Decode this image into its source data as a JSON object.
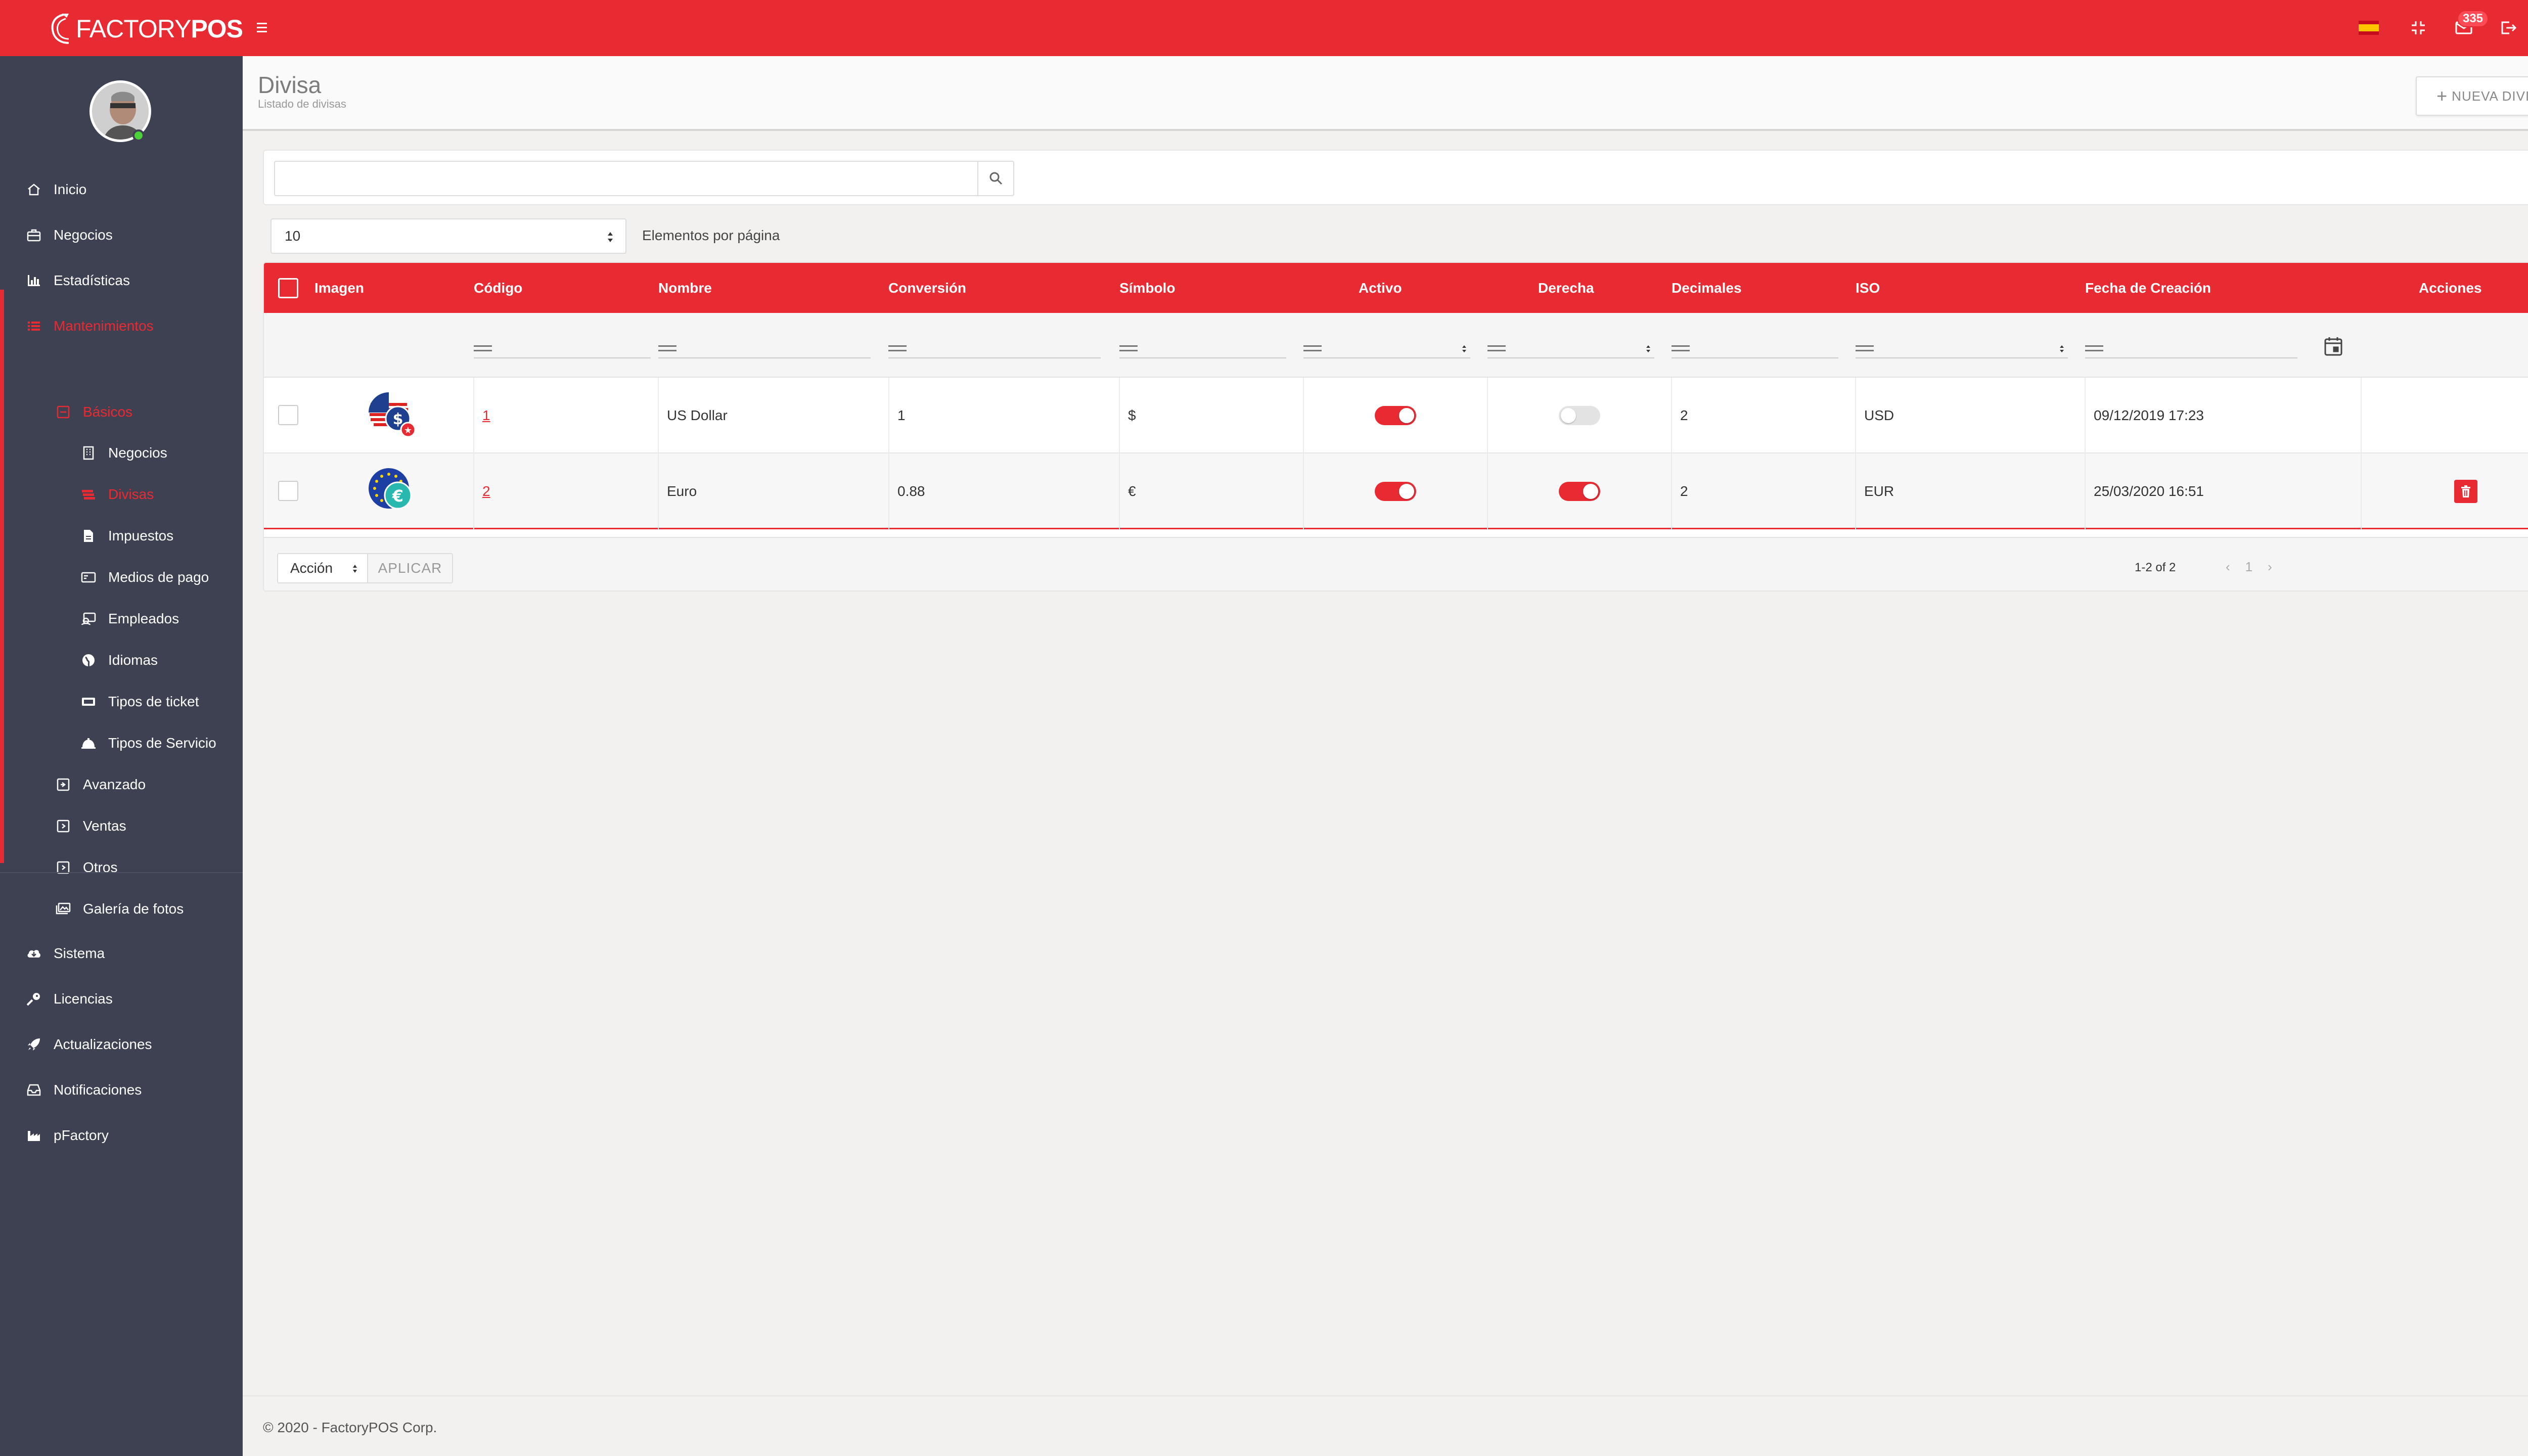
{
  "app": {
    "logo_thin": "FACTORY",
    "logo_bold": "POS",
    "notifications_count": "335"
  },
  "sidebar": {
    "items": [
      {
        "label": "Inicio",
        "icon": "home-icon"
      },
      {
        "label": "Negocios",
        "icon": "briefcase-icon"
      },
      {
        "label": "Estadísticas",
        "icon": "chart-icon"
      },
      {
        "label": "Mantenimientos",
        "icon": "list-icon"
      },
      {
        "label": "Básicos",
        "icon": "minus-square-icon"
      },
      {
        "label": "Negocios",
        "icon": "building-icon"
      },
      {
        "label": "Divisas",
        "icon": "money-icon"
      },
      {
        "label": "Impuestos",
        "icon": "file-icon"
      },
      {
        "label": "Medios de pago",
        "icon": "card-icon"
      },
      {
        "label": "Empleados",
        "icon": "user-card-icon"
      },
      {
        "label": "Idiomas",
        "icon": "globe-icon"
      },
      {
        "label": "Tipos de ticket",
        "icon": "ticket-icon"
      },
      {
        "label": "Tipos de Servicio",
        "icon": "bell-icon"
      },
      {
        "label": "Avanzado",
        "icon": "plus-square-icon"
      },
      {
        "label": "Ventas",
        "icon": "plus-square-icon"
      },
      {
        "label": "Otros",
        "icon": "plus-square-icon"
      },
      {
        "label": "Galería de fotos",
        "icon": "images-icon"
      },
      {
        "label": "Sistema",
        "icon": "cloud-icon"
      },
      {
        "label": "Licencias",
        "icon": "key-icon"
      },
      {
        "label": "Actualizaciones",
        "icon": "rocket-icon"
      },
      {
        "label": "Notificaciones",
        "icon": "inbox-icon"
      },
      {
        "label": "pFactory",
        "icon": "factory-icon"
      }
    ]
  },
  "header": {
    "title": "Divisa",
    "subtitle": "Listado de divisas",
    "new_button": "NUEVA DIVISA"
  },
  "search": {
    "value": "",
    "placeholder": ""
  },
  "per_page": {
    "value": "10",
    "label": "Elementos por página"
  },
  "table": {
    "columns": [
      "Imagen",
      "Código",
      "Nombre",
      "Conversión",
      "Símbolo",
      "Activo",
      "Derecha",
      "Decimales",
      "ISO",
      "Fecha de Creación",
      "Acciones"
    ],
    "rows": [
      {
        "code": "1",
        "name": "US Dollar",
        "conversion": "1",
        "symbol": "$",
        "active": true,
        "right": false,
        "decimals": "2",
        "iso": "USD",
        "created": "09/12/2019 17:23",
        "deletable": false
      },
      {
        "code": "2",
        "name": "Euro",
        "conversion": "0.88",
        "symbol": "€",
        "active": true,
        "right": true,
        "decimals": "2",
        "iso": "EUR",
        "created": "25/03/2020 16:51",
        "deletable": true
      }
    ]
  },
  "footer_bar": {
    "action_value": "Acción",
    "apply_label": "APLICAR",
    "pager_info": "1-2 of 2",
    "current_page": "1"
  },
  "copyright": "© 2020 - FactoryPOS Corp.",
  "colors": {
    "brand": "#e82a33",
    "sidebar": "#3d4152"
  }
}
